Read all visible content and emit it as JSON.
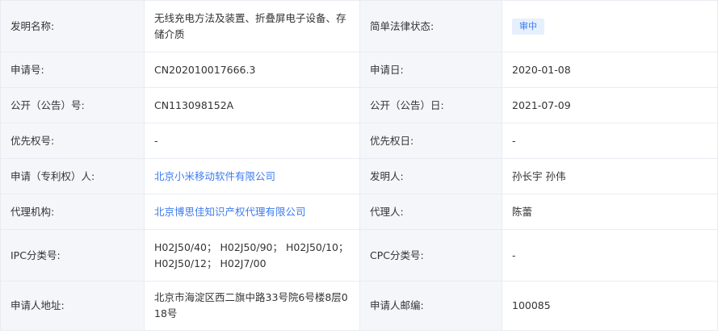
{
  "rows": [
    {
      "l1": "发明名称:",
      "v1": "无线充电方法及装置、折叠屏电子设备、存储介质",
      "l2": "简单法律状态:",
      "v2": "审中"
    },
    {
      "l1": "申请号:",
      "v1": "CN202010017666.3",
      "l2": "申请日:",
      "v2": "2020-01-08"
    },
    {
      "l1": "公开（公告）号:",
      "v1": "CN113098152A",
      "l2": "公开（公告）日:",
      "v2": "2021-07-09"
    },
    {
      "l1": "优先权号:",
      "v1": "-",
      "l2": "优先权日:",
      "v2": "-"
    },
    {
      "l1": "申请（专利权）人:",
      "v1": "北京小米移动软件有限公司",
      "l2": "发明人:",
      "v2": "孙长宇 孙伟"
    },
    {
      "l1": "代理机构:",
      "v1": "北京博思佳知识产权代理有限公司",
      "l2": "代理人:",
      "v2": "陈蕾"
    },
    {
      "l1": "IPC分类号:",
      "v1": "H02J50/40； H02J50/90； H02J50/10； H02J50/12； H02J7/00",
      "l2": "CPC分类号:",
      "v2": "-"
    },
    {
      "l1": "申请人地址:",
      "v1": "北京市海淀区西二旗中路33号院6号楼8层018号",
      "l2": "申请人邮编:",
      "v2": "100085"
    }
  ],
  "colors": {
    "link": "#3d7bf0",
    "label_bg": "#f4f6fa",
    "border": "#e8ecf2",
    "badge_bg": "#e6f0fd"
  }
}
